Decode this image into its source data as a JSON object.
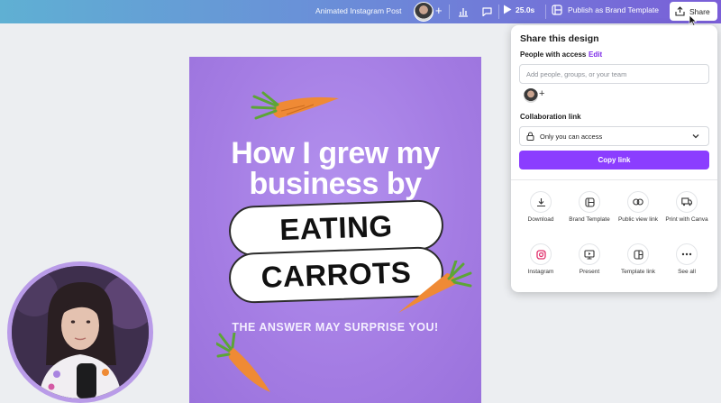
{
  "topbar": {
    "title": "Animated Instagram Post",
    "duration": "25.0s",
    "brand_label": "Publish as Brand Template",
    "share_label": "Share",
    "colors": {
      "gradient_start": "#5fb0d3",
      "gradient_end": "#7a5ed8"
    }
  },
  "design": {
    "headline_line1": "How I grew my",
    "headline_line2": "business by",
    "pill1": "EATING",
    "pill2": "CARROTS",
    "subtext": "THE ANSWER MAY SURPRISE YOU!",
    "background_color": "#a983e6"
  },
  "share_panel": {
    "title": "Share this design",
    "people_label": "People with access",
    "edit_label": "Edit",
    "add_placeholder": "Add people, groups, or your team",
    "collab_label": "Collaboration link",
    "access_value": "Only you can access",
    "copy_link_label": "Copy link",
    "accent_color": "#8b3dff",
    "options": [
      {
        "label": "Download",
        "icon": "download-icon"
      },
      {
        "label": "Brand Template",
        "icon": "brand-template-icon"
      },
      {
        "label": "Public view link",
        "icon": "link-icon"
      },
      {
        "label": "Print with Canva",
        "icon": "truck-icon"
      },
      {
        "label": "Instagram",
        "icon": "instagram-icon"
      },
      {
        "label": "Present",
        "icon": "present-icon"
      },
      {
        "label": "Template link",
        "icon": "template-link-icon"
      },
      {
        "label": "See all",
        "icon": "more-icon"
      }
    ]
  }
}
